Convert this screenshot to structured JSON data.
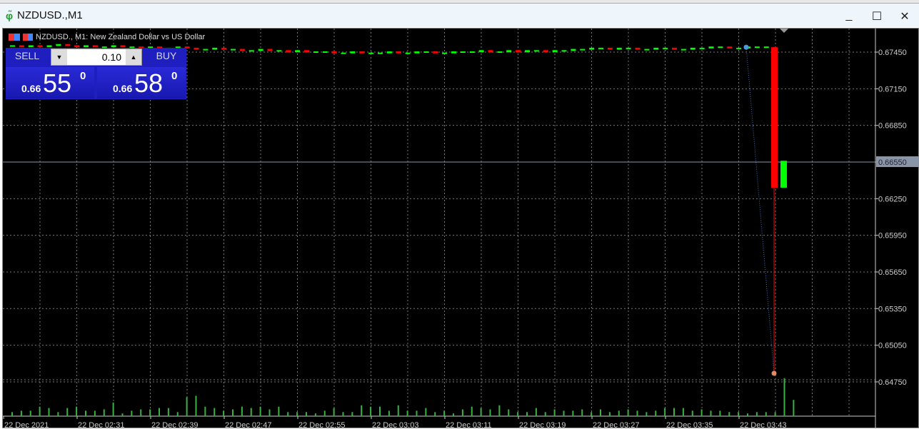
{
  "window": {
    "title": "NZDUSD.,M1",
    "minimize": "_",
    "maximize": "☐",
    "close": "✕"
  },
  "legend": {
    "text": "NZDUSD., M1:  New Zealand Dollar vs US Dollar"
  },
  "trade": {
    "sell_label": "SELL",
    "buy_label": "BUY",
    "lot": "0.10",
    "sell_prefix": "0.66",
    "sell_big": "55",
    "sell_sup": "0",
    "buy_prefix": "0.66",
    "buy_big": "58",
    "buy_sup": "0"
  },
  "colors": {
    "bull": "#00ff00",
    "bear": "#ff0000",
    "grid": "#777777",
    "bg": "#000000",
    "volume": "#3cb043"
  },
  "chart_data": {
    "type": "candlestick",
    "symbol": "NZDUSD.",
    "timeframe": "M1",
    "y_ticks": [
      "0.67450",
      "0.67150",
      "0.66850",
      "0.66550",
      "0.66250",
      "0.65950",
      "0.65650",
      "0.65350",
      "0.65050",
      "0.64750"
    ],
    "current_price": "0.66550",
    "x_ticks": [
      "22 Dec 2021",
      "22 Dec 02:31",
      "22 Dec 02:39",
      "22 Dec 02:47",
      "22 Dec 02:55",
      "22 Dec 03:03",
      "22 Dec 03:11",
      "22 Dec 03:19",
      "22 Dec 03:27",
      "22 Dec 03:35",
      "22 Dec 03:43"
    ],
    "ylim": [
      0.646,
      0.6764
    ],
    "closes": [
      0.675,
      0.6749,
      0.675,
      0.6749,
      0.675,
      0.6751,
      0.675,
      0.6749,
      0.675,
      0.6749,
      0.6749,
      0.675,
      0.6749,
      0.6749,
      0.6748,
      0.6749,
      0.6748,
      0.6748,
      0.6749,
      0.6748,
      0.6747,
      0.6747,
      0.6748,
      0.6747,
      0.6747,
      0.6746,
      0.6746,
      0.6747,
      0.6746,
      0.6746,
      0.6745,
      0.6746,
      0.6745,
      0.6745,
      0.6745,
      0.6744,
      0.6744,
      0.6745,
      0.6744,
      0.6744,
      0.6744,
      0.6745,
      0.6744,
      0.6744,
      0.6745,
      0.6745,
      0.6744,
      0.6744,
      0.6745,
      0.6745,
      0.6745,
      0.6746,
      0.6745,
      0.6745,
      0.6746,
      0.6745,
      0.6746,
      0.6746,
      0.6745,
      0.6746,
      0.6746,
      0.6747,
      0.6747,
      0.6748,
      0.6748,
      0.6747,
      0.6748,
      0.6748,
      0.6747,
      0.6747,
      0.6748,
      0.6748,
      0.6747,
      0.6747,
      0.6748,
      0.6748,
      0.6749,
      0.6749,
      0.6748,
      0.6748,
      0.6749,
      0.6749,
      0.6749
    ],
    "last_candles": [
      {
        "open": 0.6749,
        "high": 0.6749,
        "low": 0.6482,
        "close": 0.6634
      },
      {
        "open": 0.6634,
        "high": 0.6656,
        "low": 0.6634,
        "close": 0.6656
      }
    ],
    "volumes": [
      3,
      4,
      4,
      7,
      6,
      3,
      6,
      7,
      4,
      4,
      5,
      10,
      2,
      4,
      5,
      5,
      6,
      6,
      3,
      14,
      15,
      7,
      6,
      4,
      5,
      7,
      6,
      7,
      5,
      7,
      3,
      3,
      3,
      2,
      4,
      6,
      3,
      3,
      8,
      7,
      7,
      4,
      8,
      4,
      4,
      6,
      3,
      4,
      2,
      5,
      7,
      6,
      5,
      8,
      5,
      3,
      3,
      6,
      3,
      5,
      4,
      4,
      5,
      3,
      5,
      3,
      4,
      5,
      4,
      3,
      4,
      6,
      6,
      6,
      4,
      5,
      4,
      4,
      3,
      3,
      2,
      3,
      3,
      3,
      28,
      12
    ]
  }
}
